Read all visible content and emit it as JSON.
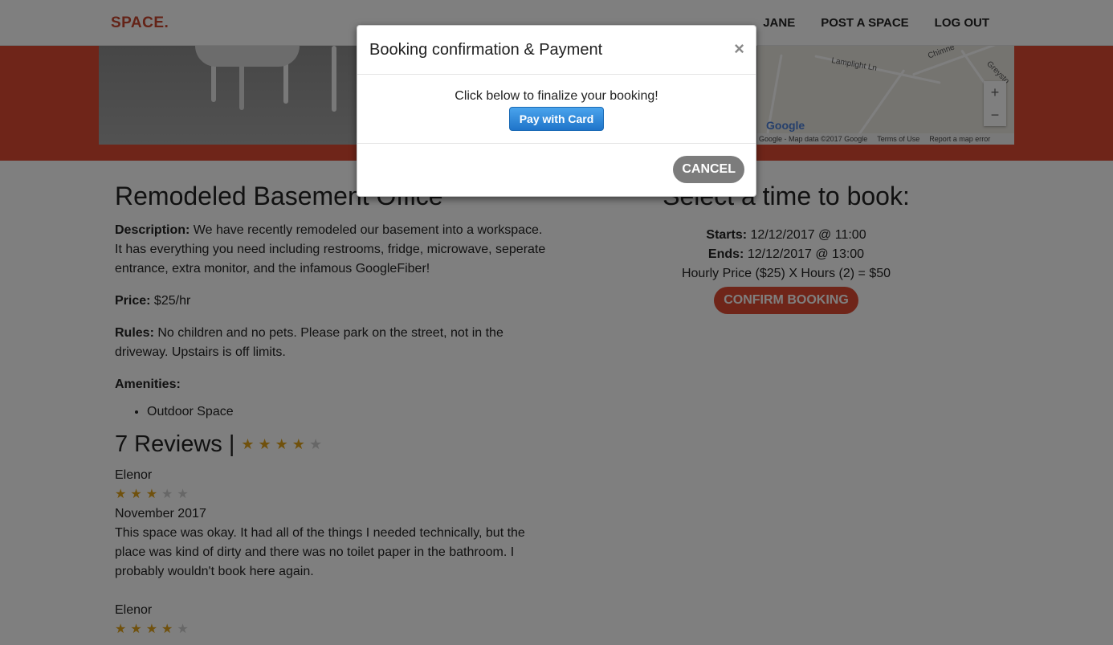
{
  "navbar": {
    "brand": "SPACE.",
    "links": [
      "JANE",
      "POST A SPACE",
      "LOG OUT"
    ]
  },
  "map": {
    "road_labels": [
      "Lamplight Ln",
      "Chimne",
      "Greysto"
    ],
    "zoom_in": "+",
    "zoom_out": "−",
    "logo": "Google",
    "footer": [
      "Google - Map data ©2017 Google",
      "Terms of Use",
      "Report a map error"
    ]
  },
  "listing": {
    "title": "Remodeled Basement Office",
    "description_label": "Description:",
    "description": "We have recently remodeled our basement into a workspace. It has everything you need including restrooms, fridge, microwave, seperate entrance, extra monitor, and the infamous GoogleFiber!",
    "price_label": "Price:",
    "price": "$25/hr",
    "rules_label": "Rules:",
    "rules": "No children and no pets. Please park on the street, not in the driveway. Upstairs is off limits.",
    "amenities_label": "Amenities:",
    "amenities": [
      "Outdoor Space"
    ]
  },
  "reviews": {
    "heading": "7 Reviews |",
    "average_stars": 4,
    "items": [
      {
        "author": "Elenor",
        "stars": 3,
        "date": "November 2017",
        "text": "This space was okay. It had all of the things I needed technically, but the place was kind of dirty and there was no toilet paper in the bathroom. I probably wouldn't book here again."
      },
      {
        "author": "Elenor",
        "stars": 4
      }
    ]
  },
  "booking": {
    "title": "Select a time to book:",
    "starts_label": "Starts:",
    "starts": "12/12/2017 @ 11:00",
    "ends_label": "Ends:",
    "ends": "12/12/2017 @ 13:00",
    "price_line": "Hourly Price ($25) X Hours (2) = $50",
    "confirm_label": "CONFIRM BOOKING"
  },
  "modal": {
    "title": "Booking confirmation & Payment",
    "close": "×",
    "message": "Click below to finalize your booking!",
    "pay_label": "Pay with Card",
    "cancel_label": "CANCEL"
  },
  "colors": {
    "brand": "#c9462f",
    "accent": "#de4b33",
    "pay_button": "#1f74c9",
    "cancel_button": "#7c7c7c",
    "star_on": "#e0a21a",
    "star_off": "#cfcfcf"
  }
}
